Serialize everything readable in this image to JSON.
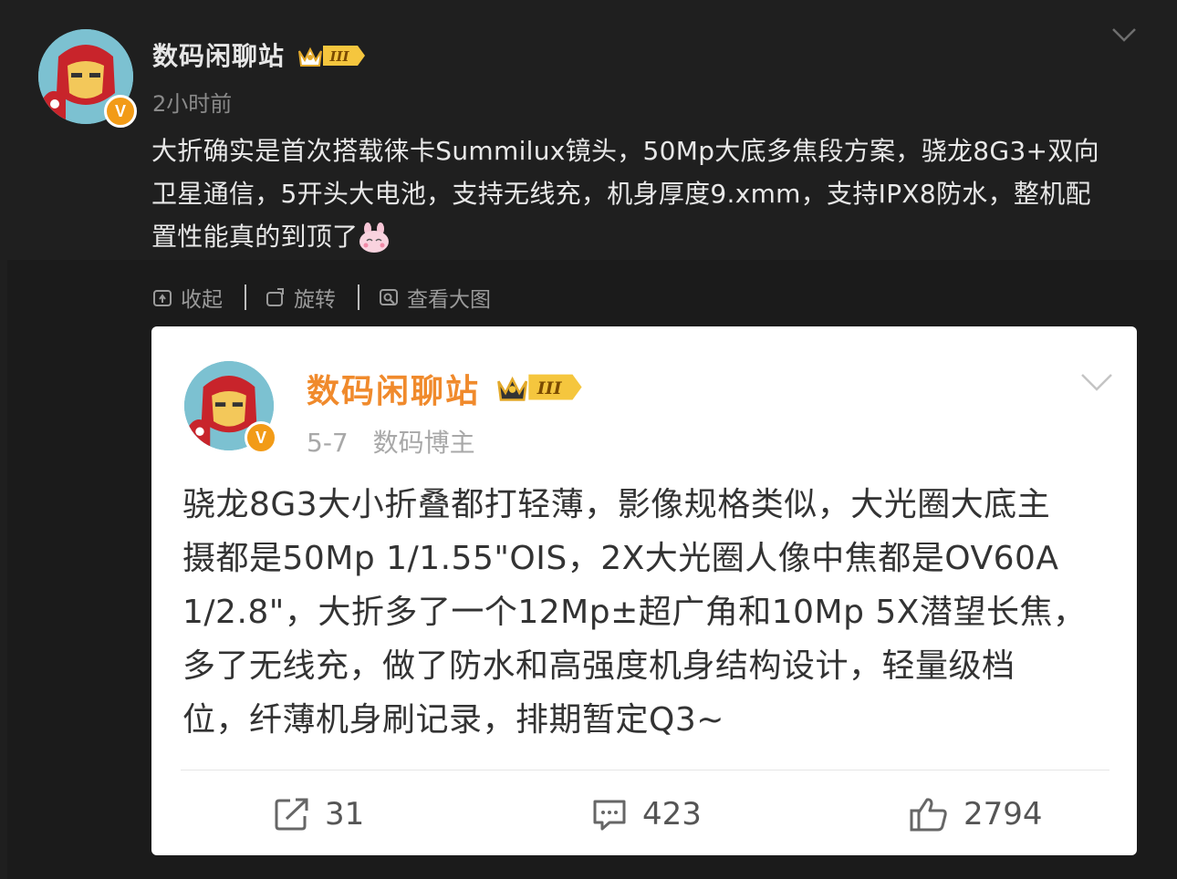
{
  "post": {
    "author": "数码闲聊站",
    "time": "2小时前",
    "content_lines": [
      "大折确实是首次搭载徕卡Summilux镜头，50Mp大底多焦段方案，骁龙8G3+双向",
      "卫星通信，5开头大电池，支持无线充，机身厚度9.xmm，支持IPX8防水，整机配",
      "置性能真的到顶了"
    ],
    "level_badge": "III",
    "verified_badge": "V"
  },
  "actions": {
    "collapse": "收起",
    "rotate": "旋转",
    "view_large": "查看大图"
  },
  "card": {
    "author": "数码闲聊站",
    "date": "5-7",
    "role": "数码博主",
    "level_badge": "III",
    "verified_badge": "V",
    "lines": [
      "骁龙8G3大小折叠都打轻薄，影像规格类似，大光圈大底主",
      "摄都是50Mp 1/1.55\"OIS，2X大光圈人像中焦都是OV60A",
      "1/2.8\"，大折多了一个12Mp±超广角和10Mp 5X潜望长焦，",
      "多了无线充，做了防水和高强度机身结构设计，轻量级档",
      "位，纤薄机身刷记录，排期暂定Q3~"
    ],
    "repost_count": "31",
    "comment_count": "423",
    "like_count": "2794"
  },
  "colors": {
    "background": "#1f1f1f",
    "card_author": "#f08a2c",
    "verified": "#f29b17"
  }
}
